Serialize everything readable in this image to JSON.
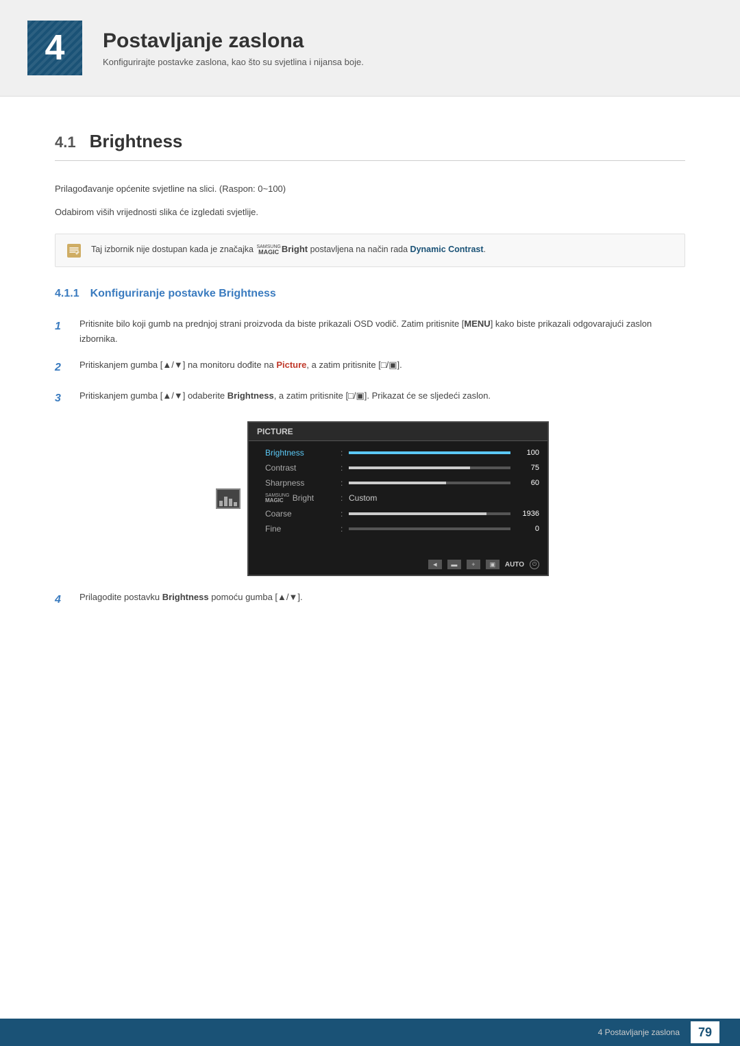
{
  "header": {
    "chapter_number": "4",
    "chapter_title": "Postavljanje zaslona",
    "chapter_subtitle": "Konfigurirajte postavke zaslona, kao što su svjetlina i nijansa boje."
  },
  "section": {
    "number": "4.1",
    "title": "Brightness"
  },
  "intro": {
    "line1": "Prilagođavanje općenite svjetline na slici. (Raspon: 0~100)",
    "line2": "Odabirom viših vrijednosti slika će izgledati svjetlije."
  },
  "note": {
    "text_prefix": "Taj izbornik nije dostupan kada je značajka ",
    "magic_bright": "SAMSUNG MAGIC Bright",
    "text_middle": " postavljena na način rada ",
    "dynamic_contrast": "Dynamic Contrast",
    "text_suffix": "."
  },
  "subsection": {
    "number": "4.1.1",
    "title": "Konfiguriranje postavke Brightness"
  },
  "steps": [
    {
      "num": "1",
      "text_parts": [
        "Pritisnite bilo koji gumb na prednjoj strani proizvoda da biste prikazali OSD vodič. Zatim pritisnite [",
        "MENU",
        "] kako biste prikazali odgovarajući zaslon izbornika."
      ]
    },
    {
      "num": "2",
      "text_parts": [
        "Pritiskanjem gumba [▲/▼] na monitoru dođite na ",
        "Picture",
        ", a zatim pritisnite [□/▣]."
      ]
    },
    {
      "num": "3",
      "text_parts": [
        "Pritiskanjem gumba [▲/▼] odaberite ",
        "Brightness",
        ", a zatim pritisnite [□/▣]. Prikazat će se sljedeći zaslon."
      ]
    }
  ],
  "step4": {
    "num": "4",
    "text_prefix": "Prilagodite postavku ",
    "bold": "Brightness",
    "text_suffix": " pomoću gumba [▲/▼]."
  },
  "osd": {
    "title": "PICTURE",
    "items": [
      {
        "label": "Brightness",
        "type": "bar",
        "fill_pct": 100,
        "value": "100",
        "active": true
      },
      {
        "label": "Contrast",
        "type": "bar",
        "fill_pct": 75,
        "value": "75",
        "active": false
      },
      {
        "label": "Sharpness",
        "type": "bar",
        "fill_pct": 60,
        "value": "60",
        "active": false
      },
      {
        "label": "MAGIC Bright",
        "type": "text",
        "value": "Custom",
        "active": false
      },
      {
        "label": "Coarse",
        "type": "bar",
        "fill_pct": 85,
        "value": "1936",
        "active": false
      },
      {
        "label": "Fine",
        "type": "bar",
        "fill_pct": 0,
        "value": "0",
        "active": false
      }
    ],
    "controls": [
      "◄",
      "▬",
      "＋",
      "▣",
      "AUTO",
      "⏻"
    ]
  },
  "footer": {
    "chapter_text": "4 Postavljanje zaslona",
    "page_number": "79"
  }
}
